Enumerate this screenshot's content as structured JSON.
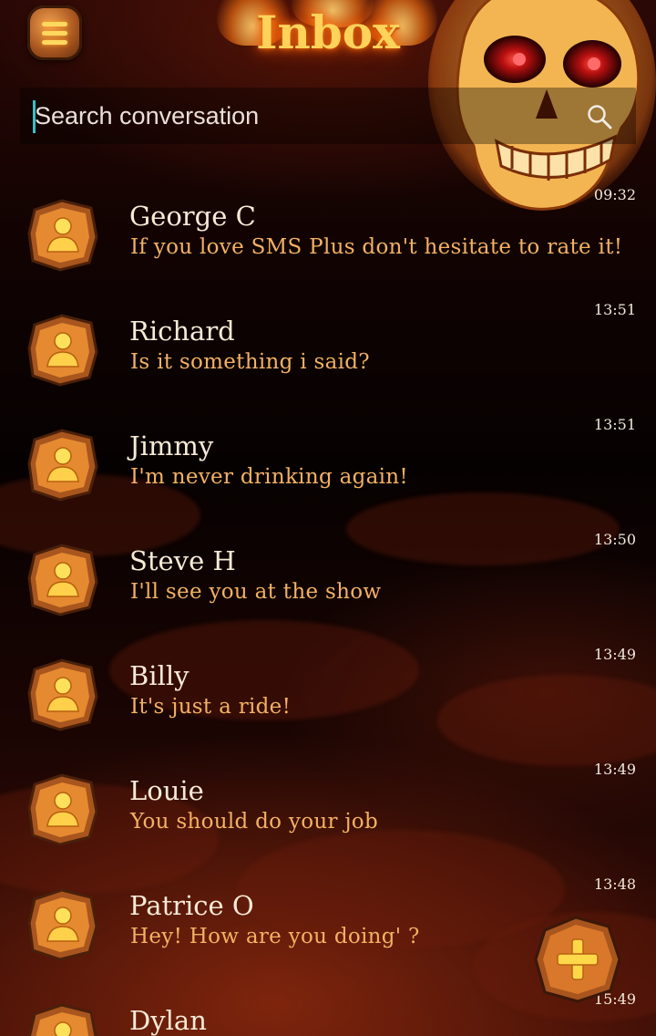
{
  "header": {
    "title": "Inbox",
    "menu_icon": "hamburger-menu-icon"
  },
  "search": {
    "placeholder": "Search conversation",
    "icon": "search-icon"
  },
  "conversations": [
    {
      "name": "George C",
      "message": "If you love SMS Plus don't hesitate to rate it!",
      "time": "09:32"
    },
    {
      "name": "Richard",
      "message": "Is it something i said?",
      "time": "13:51"
    },
    {
      "name": "Jimmy",
      "message": "I'm never drinking again!",
      "time": "13:51"
    },
    {
      "name": "Steve H",
      "message": "I'll see you at the show",
      "time": "13:50"
    },
    {
      "name": "Billy",
      "message": "It's just a ride!",
      "time": "13:49"
    },
    {
      "name": "Louie",
      "message": "You should do your job",
      "time": "13:49"
    },
    {
      "name": "Patrice O",
      "message": "Hey! How are you doing' ?",
      "time": "13:48"
    },
    {
      "name": "Dylan",
      "message": "",
      "time": "15:49"
    }
  ],
  "fab": {
    "icon": "plus-icon"
  },
  "colors": {
    "accent": "#ffd35a",
    "message_text": "#f3b163",
    "name_text": "#f7ead6",
    "caret": "#37c0c8"
  }
}
